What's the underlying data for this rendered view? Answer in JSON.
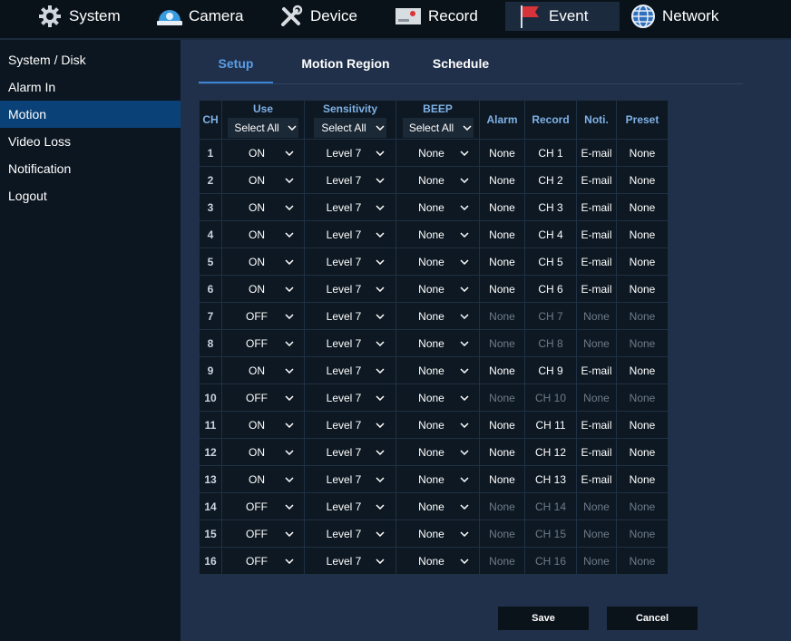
{
  "nav": {
    "items": [
      {
        "label": "System",
        "icon": "gear-icon"
      },
      {
        "label": "Camera",
        "icon": "camera-icon"
      },
      {
        "label": "Device",
        "icon": "tools-icon"
      },
      {
        "label": "Record",
        "icon": "record-icon"
      },
      {
        "label": "Event",
        "icon": "flag-icon",
        "active": true
      },
      {
        "label": "Network",
        "icon": "globe-icon"
      }
    ]
  },
  "sidebar": {
    "items": [
      {
        "label": "System / Disk"
      },
      {
        "label": "Alarm In"
      },
      {
        "label": "Motion",
        "active": true
      },
      {
        "label": "Video Loss"
      },
      {
        "label": "Notification"
      },
      {
        "label": "Logout"
      }
    ]
  },
  "tabs": [
    {
      "label": "Setup",
      "active": true
    },
    {
      "label": "Motion Region"
    },
    {
      "label": "Schedule"
    }
  ],
  "table": {
    "headers": {
      "ch": "CH",
      "use": "Use",
      "sensitivity": "Sensitivity",
      "beep": "BEEP",
      "alarm": "Alarm",
      "record": "Record",
      "noti": "Noti.",
      "preset": "Preset"
    },
    "select_all": "Select All",
    "rows": [
      {
        "ch": "1",
        "use": "ON",
        "sens": "Level 7",
        "beep": "None",
        "alarm": "None",
        "record": "CH 1",
        "noti": "E-mail",
        "preset": "None"
      },
      {
        "ch": "2",
        "use": "ON",
        "sens": "Level 7",
        "beep": "None",
        "alarm": "None",
        "record": "CH 2",
        "noti": "E-mail",
        "preset": "None"
      },
      {
        "ch": "3",
        "use": "ON",
        "sens": "Level 7",
        "beep": "None",
        "alarm": "None",
        "record": "CH 3",
        "noti": "E-mail",
        "preset": "None"
      },
      {
        "ch": "4",
        "use": "ON",
        "sens": "Level 7",
        "beep": "None",
        "alarm": "None",
        "record": "CH 4",
        "noti": "E-mail",
        "preset": "None"
      },
      {
        "ch": "5",
        "use": "ON",
        "sens": "Level 7",
        "beep": "None",
        "alarm": "None",
        "record": "CH 5",
        "noti": "E-mail",
        "preset": "None"
      },
      {
        "ch": "6",
        "use": "ON",
        "sens": "Level 7",
        "beep": "None",
        "alarm": "None",
        "record": "CH 6",
        "noti": "E-mail",
        "preset": "None"
      },
      {
        "ch": "7",
        "use": "OFF",
        "sens": "Level 7",
        "beep": "None",
        "alarm": "None",
        "record": "CH 7",
        "noti": "None",
        "preset": "None"
      },
      {
        "ch": "8",
        "use": "OFF",
        "sens": "Level 7",
        "beep": "None",
        "alarm": "None",
        "record": "CH 8",
        "noti": "None",
        "preset": "None"
      },
      {
        "ch": "9",
        "use": "ON",
        "sens": "Level 7",
        "beep": "None",
        "alarm": "None",
        "record": "CH 9",
        "noti": "E-mail",
        "preset": "None"
      },
      {
        "ch": "10",
        "use": "OFF",
        "sens": "Level 7",
        "beep": "None",
        "alarm": "None",
        "record": "CH 10",
        "noti": "None",
        "preset": "None"
      },
      {
        "ch": "11",
        "use": "ON",
        "sens": "Level 7",
        "beep": "None",
        "alarm": "None",
        "record": "CH 11",
        "noti": "E-mail",
        "preset": "None"
      },
      {
        "ch": "12",
        "use": "ON",
        "sens": "Level 7",
        "beep": "None",
        "alarm": "None",
        "record": "CH 12",
        "noti": "E-mail",
        "preset": "None"
      },
      {
        "ch": "13",
        "use": "ON",
        "sens": "Level 7",
        "beep": "None",
        "alarm": "None",
        "record": "CH 13",
        "noti": "E-mail",
        "preset": "None"
      },
      {
        "ch": "14",
        "use": "OFF",
        "sens": "Level 7",
        "beep": "None",
        "alarm": "None",
        "record": "CH 14",
        "noti": "None",
        "preset": "None"
      },
      {
        "ch": "15",
        "use": "OFF",
        "sens": "Level 7",
        "beep": "None",
        "alarm": "None",
        "record": "CH 15",
        "noti": "None",
        "preset": "None"
      },
      {
        "ch": "16",
        "use": "OFF",
        "sens": "Level 7",
        "beep": "None",
        "alarm": "None",
        "record": "CH 16",
        "noti": "None",
        "preset": "None"
      }
    ]
  },
  "buttons": {
    "save": "Save",
    "cancel": "Cancel"
  },
  "colors": {
    "accent": "#3b83d6",
    "header_text": "#7fb1e6",
    "active_side": "#0a4278",
    "panel": "#20304a"
  }
}
